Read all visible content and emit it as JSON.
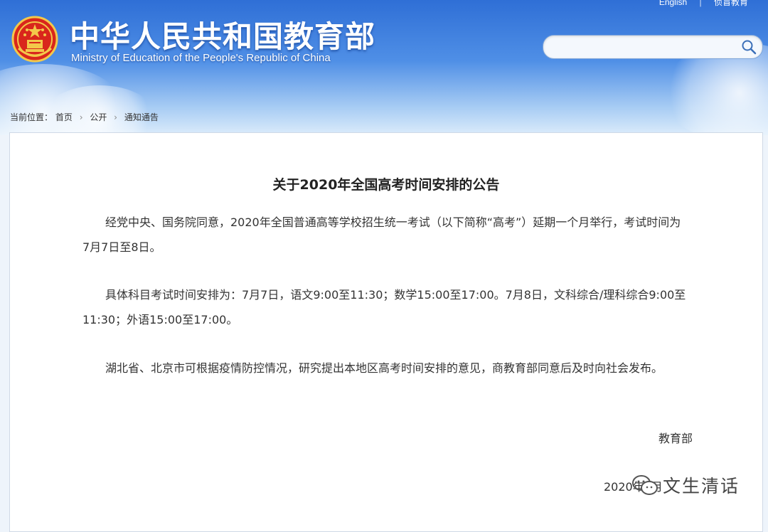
{
  "header": {
    "title": "中华人民共和国教育部",
    "subtitle": "Ministry of Education of the People's Republic of China",
    "top_links": [
      "English",
      "侦盲教育"
    ],
    "search": {
      "value": "",
      "placeholder": ""
    },
    "emblem_icon": "national-emblem-icon",
    "search_icon": "magnifier-icon"
  },
  "breadcrumb": {
    "prefix": "当前位置：",
    "items": [
      "首页",
      "公开",
      "通知通告"
    ]
  },
  "article": {
    "title": "关于2020年全国高考时间安排的公告",
    "paragraphs": [
      "经党中央、国务院同意，2020年全国普通高等学校招生统一考试（以下简称“高考”）延期一个月举行，考试时间为7月7日至8日。",
      "具体科目考试时间安排为：7月7日，语文9:00至11:30；数学15:00至17:00。7月8日，文科综合/理科综合9:00至11:30；外语15:00至17:00。",
      "湖北省、北京市可根据疫情防控情况，研究提出本地区高考时间安排的意见，商教育部同意后及时向社会发布。"
    ],
    "signature": "教育部",
    "date_partial": "2020年3月"
  },
  "watermark": {
    "text": "文生清话",
    "icon": "wechat-icon"
  },
  "colors": {
    "header_blue": "#2f6fd6",
    "emblem_red": "#d9261c",
    "emblem_gold": "#f3c84a"
  }
}
